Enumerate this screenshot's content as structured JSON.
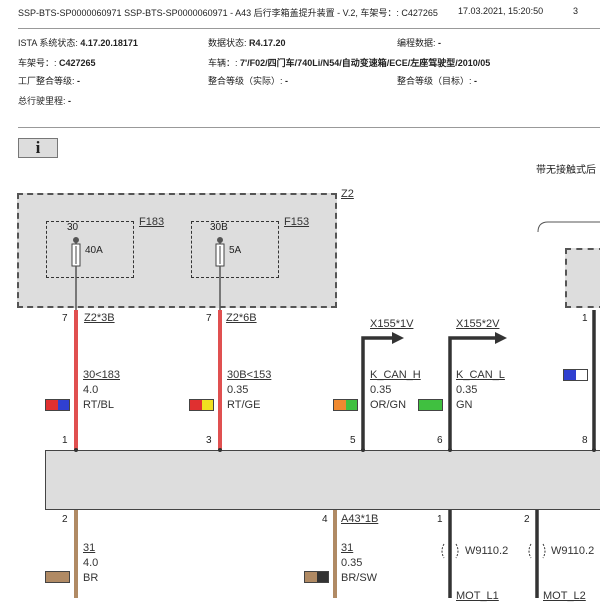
{
  "header": {
    "title": "SSP-BTS-SP0000060971 SSP-BTS-SP0000060971 - A43 后行李箱盖提升装置 - V.2, 车架号：: C427265",
    "datetime": "17.03.2021, 15:20:50",
    "page": "3"
  },
  "info": {
    "ista_label": "ISTA 系统状态:",
    "ista_value": "4.17.20.18171",
    "data_label": "数据状态:",
    "data_value": "R4.17.20",
    "prog_label": "编程数据:",
    "prog_value": "-",
    "vin_label": "车架号：:",
    "vin_value": "C427265",
    "vehicle_label": "车辆：:",
    "vehicle_value": "7'/F02/四门车/740Li/N54/自动变速箱/ECE/左座驾驶型/2010/05",
    "factory_label": "工厂整合等级:",
    "factory_value": "-",
    "actual_label": "整合等级（实际）:",
    "actual_value": "-",
    "target_label": "整合等级（目标）:",
    "target_value": "-",
    "mileage_label": "总行驶里程:",
    "mileage_value": "-"
  },
  "info_icon": "i",
  "diagram_caption": "带无接触式后",
  "diagram": {
    "z2": "Z2",
    "f183": "F183",
    "f153": "F153",
    "f183_pin": "30",
    "f183_amp": "40A",
    "f153_pin": "30B",
    "f153_amp": "5A",
    "pin7a": "7",
    "pin7b": "7",
    "pin1_top_right": "1",
    "z2_3b": "Z2*3B",
    "z2_6b": "Z2*6B",
    "x155_1v": "X155*1V",
    "x155_2v": "X155*2V",
    "w1_name": "30<183",
    "w1_size": "4.0",
    "w1_color": "RT/BL",
    "w2_name": "30B<153",
    "w2_size": "0.35",
    "w2_color": "RT/GE",
    "w3_name": "K_CAN_H",
    "w3_size": "0.35",
    "w3_color": "OR/GN",
    "w4_name": "K_CAN_L",
    "w4_size": "0.35",
    "w4_color": "GN",
    "pin1": "1",
    "pin3": "3",
    "pin5": "5",
    "pin6": "6",
    "pin8": "8",
    "pin2": "2",
    "pin4": "4",
    "pin1b": "1",
    "pin2b": "2",
    "a43_1b": "A43*1B",
    "w5_name": "31",
    "w5_size": "4.0",
    "w5_color": "BR",
    "w6_name": "31",
    "w6_size": "0.35",
    "w6_color": "BR/SW",
    "w9110a": "W9110.2",
    "w9110b": "W9110.2",
    "mot1": "MOT_L1",
    "mot2": "MOT_L2"
  },
  "colors": {
    "red_wire": "#e05050",
    "brown_wire": "#b08a64",
    "dark_wire": "#333333",
    "box_gray": "#dddddd",
    "link": "#2b3fd6"
  }
}
